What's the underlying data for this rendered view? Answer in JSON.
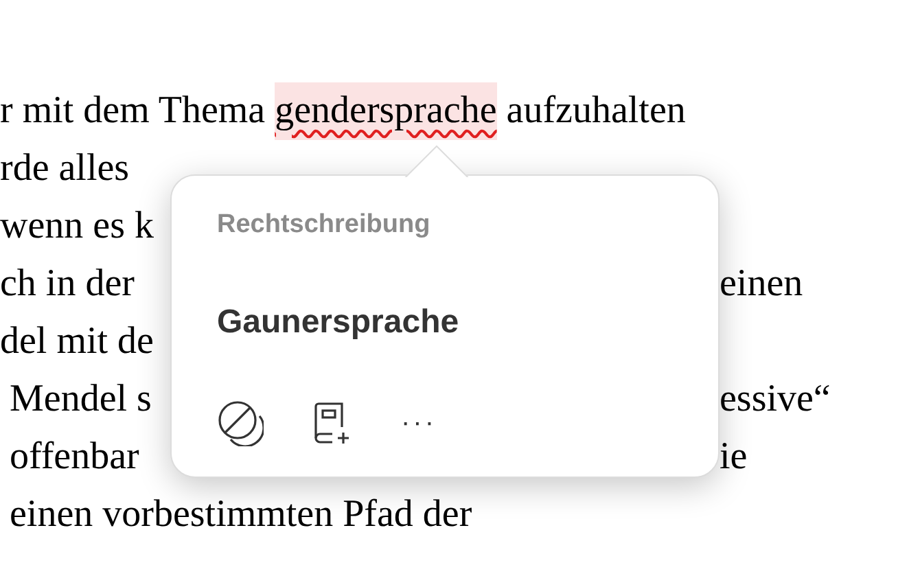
{
  "document": {
    "lines": [
      {
        "kind": "misspelled",
        "before": "r mit dem Thema ",
        "word": "gendersprache",
        "after": " aufzuhalten"
      },
      {
        "kind": "split",
        "left": "rde alles"
      },
      {
        "kind": "split",
        "left": "wenn es k"
      },
      {
        "kind": "split",
        "left": "ch in der",
        "right": "einen"
      },
      {
        "kind": "split",
        "left": "del mit de"
      },
      {
        "kind": "split",
        "left": " Mendel s",
        "right": "essive“"
      },
      {
        "kind": "split",
        "left": " offenbar",
        "right": "ie"
      },
      {
        "kind": "split",
        "left": " einen vorbestimmten Pfad der"
      }
    ]
  },
  "popover": {
    "heading": "Rechtschreibung",
    "suggestion": "Gaunersprache",
    "actions": [
      {
        "kind": "ignore"
      },
      {
        "kind": "learn"
      },
      {
        "kind": "more",
        "label": "···"
      }
    ]
  }
}
